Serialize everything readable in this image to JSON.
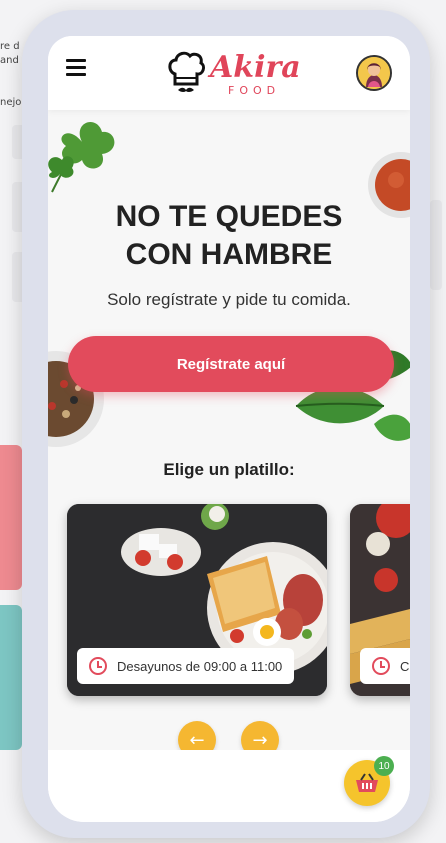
{
  "background": {
    "left_text_lines": [
      "re d",
      "and",
      "",
      "",
      "nejo"
    ]
  },
  "header": {
    "logo_word": "Akira",
    "logo_sub": "FOOD"
  },
  "hero": {
    "title_line1": "NO TE QUEDES",
    "title_line2": "CON HAMBRE",
    "subtitle": "Solo regístrate y pide tu comida.",
    "register_label": "Regístrate aquí"
  },
  "dishes": {
    "section_title": "Elige un platillo:",
    "cards": [
      {
        "label": "Desayunos de 09:00 a 11:00"
      },
      {
        "label": "C"
      }
    ],
    "prev_arrow": "←",
    "next_arrow": "→"
  },
  "cart": {
    "count": "10"
  },
  "colors": {
    "brand_red": "#e24b5c",
    "accent_yellow": "#f5b731",
    "badge_green": "#4caf50"
  }
}
